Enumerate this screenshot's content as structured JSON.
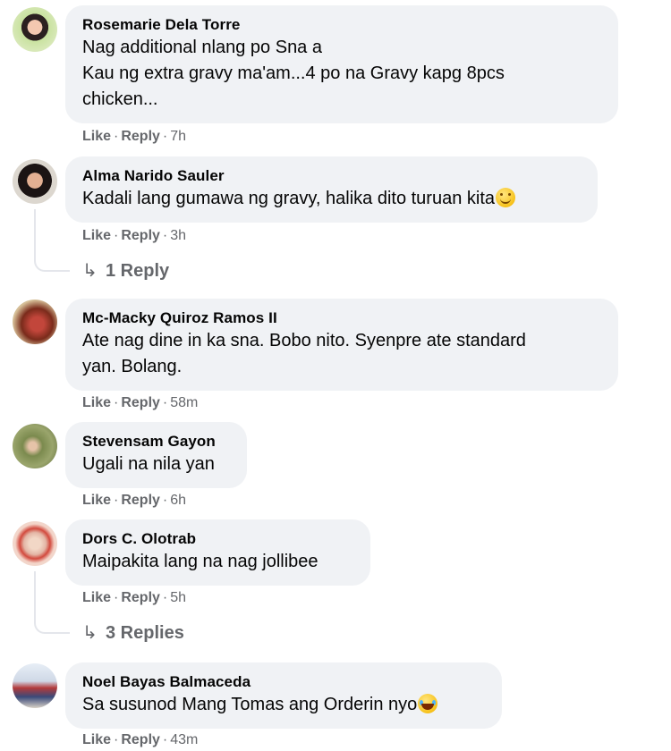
{
  "comments": [
    {
      "author": "Rosemarie Dela Torre",
      "lines": [
        "Nag additional nlang po Sna a",
        "Kau ng extra gravy ma'am...4 po na Gravy kapg 8pcs",
        "chicken..."
      ],
      "like": "Like",
      "reply": "Reply",
      "time": "7h"
    },
    {
      "author": "Alma Narido Sauler",
      "lines": [
        "Kadali lang gumawa ng gravy, halika dito turuan kita"
      ],
      "emoji": "smiling-face-emoji",
      "like": "Like",
      "reply": "Reply",
      "time": "3h",
      "replies": "1 Reply"
    },
    {
      "author": "Mc-Macky Quiroz Ramos II",
      "lines": [
        "Ate nag dine in ka sna. Bobo nito. Syenpre ate standard",
        "yan. Bolang."
      ],
      "like": "Like",
      "reply": "Reply",
      "time": "58m"
    },
    {
      "author": "Stevensam Gayon",
      "lines": [
        "Ugali na nila yan"
      ],
      "like": "Like",
      "reply": "Reply",
      "time": "6h"
    },
    {
      "author": "Dors C. Olotrab",
      "lines": [
        "Maipakita lang na nag jollibee"
      ],
      "like": "Like",
      "reply": "Reply",
      "time": "5h",
      "replies": "3 Replies"
    },
    {
      "author": "Noel Bayas Balmaceda",
      "lines": [
        "Sa susunod Mang Tomas ang Orderin nyo"
      ],
      "emoji": "laughing-tears-emoji",
      "like": "Like",
      "reply": "Reply",
      "time": "43m"
    }
  ],
  "dot": "·",
  "reply_arrow": "↳",
  "colors": {
    "bubble": "#f0f2f5",
    "meta": "#65676b",
    "text": "#050505"
  }
}
